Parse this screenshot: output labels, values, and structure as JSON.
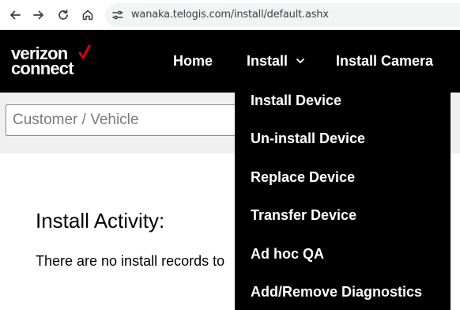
{
  "browser": {
    "url": "wanaka.telogis.com/install/default.ashx"
  },
  "brand": {
    "logo_line1": "verizon",
    "logo_line2": "connect",
    "accent_color": "#cd040b"
  },
  "nav": {
    "home": "Home",
    "install": "Install",
    "install_camera": "Install Camera"
  },
  "search": {
    "placeholder": "Customer / Vehicle"
  },
  "install_menu": {
    "items": [
      "Install Device",
      "Un-install Device",
      "Replace Device",
      "Transfer Device",
      "Ad hoc QA",
      "Add/Remove Diagnostics"
    ]
  },
  "content": {
    "title": "Install Activity:",
    "empty_message": "There are no install records to"
  }
}
